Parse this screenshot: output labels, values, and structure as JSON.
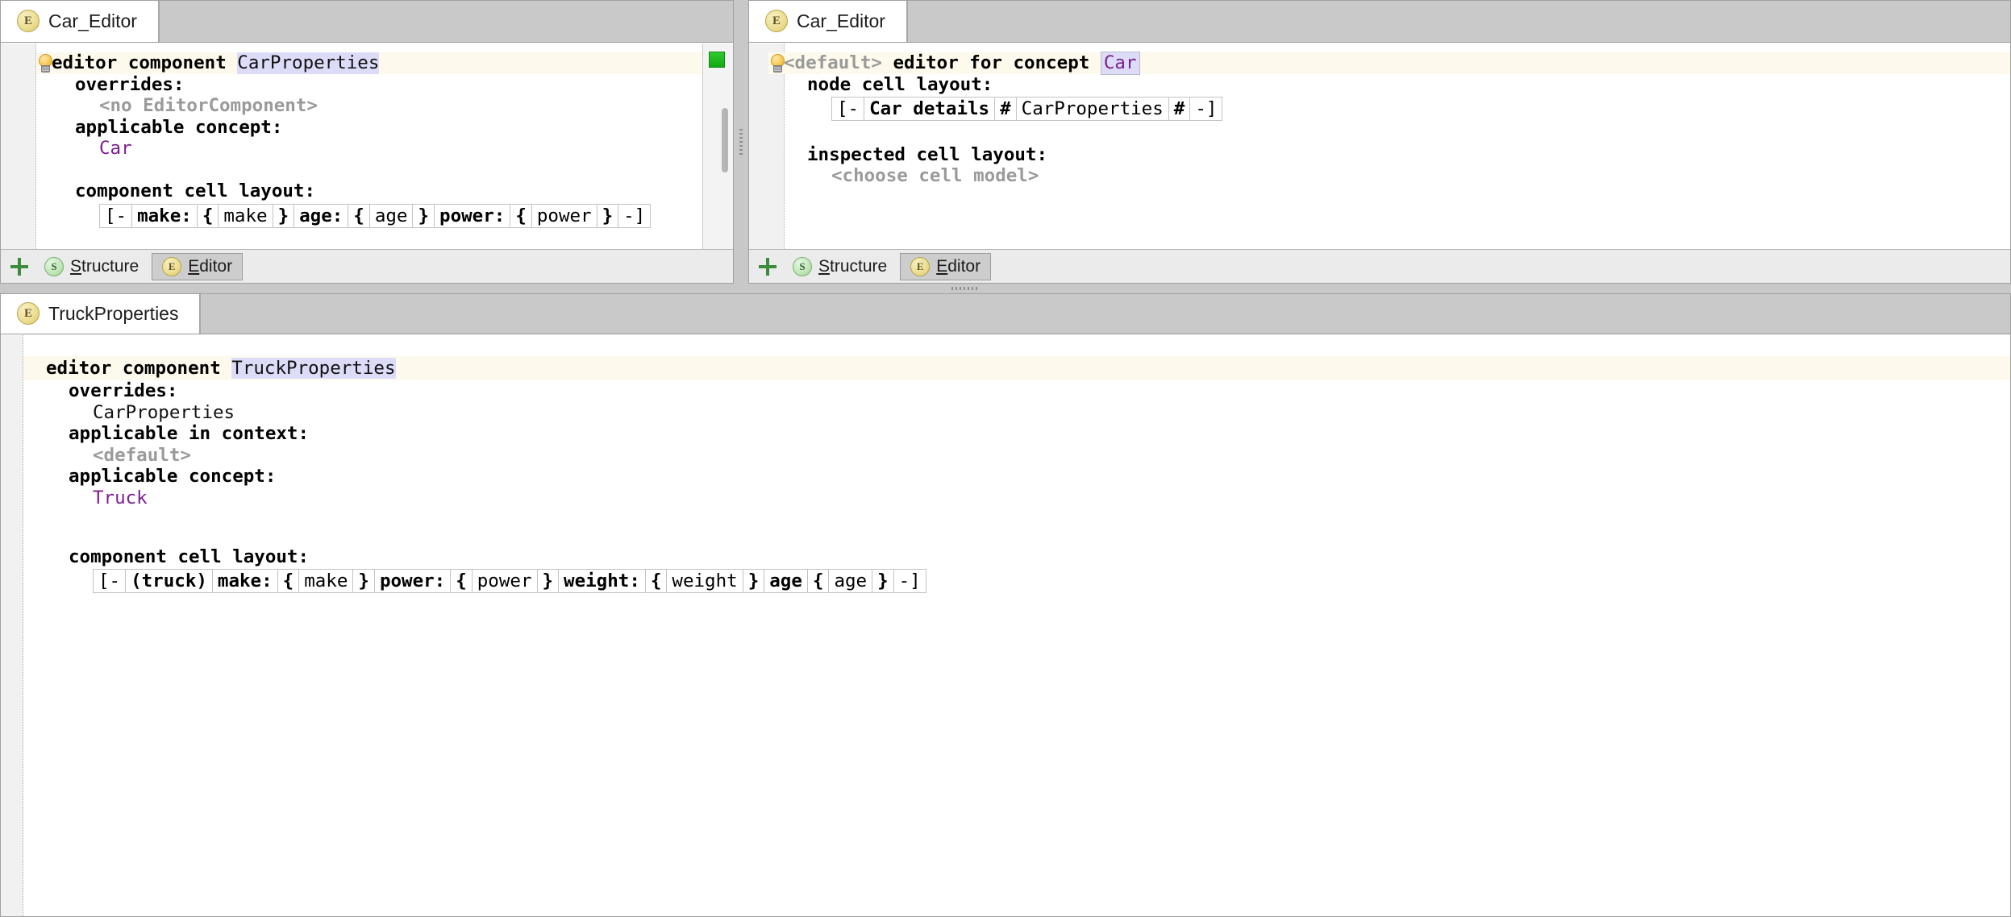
{
  "window": {
    "accent_highlight": "#dcdcf8",
    "concept_color": "#7d1f92",
    "title_row_bg": "#fdf9ec",
    "ok_marker_color": "#1faa1f"
  },
  "left_panel": {
    "tab": {
      "label": "Car_Editor",
      "icon": "editor-aspect-icon",
      "icon_letter": "E"
    },
    "root_node": {
      "keyword": "editor component",
      "name": "CarProperties",
      "hint_icon": "lightbulb-icon"
    },
    "properties": [
      {
        "label": "overrides:",
        "value": "<no EditorComponent>",
        "value_style": "gray"
      },
      {
        "label": "applicable concept:",
        "value": "Car",
        "value_style": "concept"
      }
    ],
    "cell_layout": {
      "label": "component cell layout:",
      "cells": [
        {
          "text": "[-",
          "bold": false
        },
        {
          "text": "make:",
          "bold": true
        },
        {
          "text": "{",
          "bold": true
        },
        {
          "text": "make",
          "bold": false
        },
        {
          "text": "}",
          "bold": true
        },
        {
          "text": "age:",
          "bold": true
        },
        {
          "text": "{",
          "bold": true
        },
        {
          "text": "age",
          "bold": false
        },
        {
          "text": "}",
          "bold": true
        },
        {
          "text": "power:",
          "bold": true
        },
        {
          "text": "{",
          "bold": true
        },
        {
          "text": "power",
          "bold": false
        },
        {
          "text": "}",
          "bold": true
        },
        {
          "text": "-]",
          "bold": false
        }
      ]
    },
    "footer": {
      "add_label": "+",
      "tabs": [
        {
          "label": "Structure",
          "icon_letter": "S",
          "icon": "structure-aspect-icon",
          "selected": false
        },
        {
          "label": "Editor",
          "icon_letter": "E",
          "icon": "editor-aspect-icon",
          "selected": true
        }
      ]
    }
  },
  "right_panel": {
    "tab": {
      "label": "Car_Editor",
      "icon": "editor-aspect-icon",
      "icon_letter": "E"
    },
    "root_node": {
      "prefix": "<default>",
      "keyword": "editor for concept",
      "name": "Car",
      "hint_icon": "lightbulb-icon"
    },
    "node_cell_layout": {
      "label": "node cell layout:",
      "cells": [
        {
          "text": "[-",
          "bold": false
        },
        {
          "text": "Car details",
          "bold": true
        },
        {
          "text": "#",
          "bold": true
        },
        {
          "text": "CarProperties",
          "bold": false
        },
        {
          "text": "#",
          "bold": true
        },
        {
          "text": "-]",
          "bold": false
        }
      ]
    },
    "inspected_cell_layout": {
      "label": "inspected cell layout:",
      "value": "<choose cell model>",
      "value_style": "gray"
    },
    "footer": {
      "add_label": "+",
      "tabs": [
        {
          "label": "Structure",
          "icon_letter": "S",
          "icon": "structure-aspect-icon",
          "selected": false
        },
        {
          "label": "Editor",
          "icon_letter": "E",
          "icon": "editor-aspect-icon",
          "selected": true
        }
      ]
    }
  },
  "bottom_panel": {
    "tab": {
      "label": "TruckProperties",
      "icon": "editor-aspect-icon",
      "icon_letter": "E"
    },
    "root_node": {
      "keyword": "editor component",
      "name": "TruckProperties"
    },
    "properties": [
      {
        "label": "overrides:",
        "value": "CarProperties",
        "value_style": "plain"
      },
      {
        "label": "applicable in context:",
        "value": "<default>",
        "value_style": "gray"
      },
      {
        "label": "applicable concept:",
        "value": "Truck",
        "value_style": "concept"
      }
    ],
    "cell_layout": {
      "label": "component cell layout:",
      "cells": [
        {
          "text": "[-",
          "bold": false
        },
        {
          "text": "(truck)",
          "bold": true
        },
        {
          "text": "make:",
          "bold": true
        },
        {
          "text": "{",
          "bold": true
        },
        {
          "text": "make",
          "bold": false
        },
        {
          "text": "}",
          "bold": true
        },
        {
          "text": "power:",
          "bold": true
        },
        {
          "text": "{",
          "bold": true
        },
        {
          "text": "power",
          "bold": false
        },
        {
          "text": "}",
          "bold": true
        },
        {
          "text": "weight:",
          "bold": true
        },
        {
          "text": "{",
          "bold": true
        },
        {
          "text": "weight",
          "bold": false
        },
        {
          "text": "}",
          "bold": true
        },
        {
          "text": "age",
          "bold": true
        },
        {
          "text": "{",
          "bold": true
        },
        {
          "text": "age",
          "bold": false
        },
        {
          "text": "}",
          "bold": true
        },
        {
          "text": "-]",
          "bold": false
        }
      ]
    }
  }
}
